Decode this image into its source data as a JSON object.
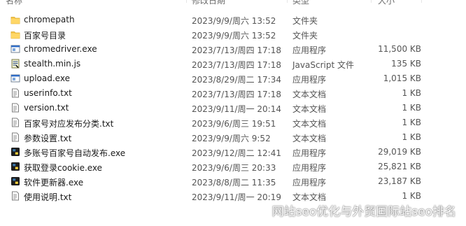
{
  "header": {
    "name_col": "名称",
    "date_col": "修改日期",
    "type_col": "类型",
    "size_col": "大小"
  },
  "files": [
    {
      "name": "chromepath",
      "date": "2023/9/9/周六 13:52",
      "type": "文件夹",
      "size": "",
      "icon": "folder-icon"
    },
    {
      "name": "百家号目录",
      "date": "2023/9/9/周六 13:52",
      "type": "文件夹",
      "size": "",
      "icon": "folder-icon"
    },
    {
      "name": "chromedriver.exe",
      "date": "2023/7/13/周四 17:18",
      "type": "应用程序",
      "size": "11,500 KB",
      "icon": "exe-window-icon"
    },
    {
      "name": "stealth.min.js",
      "date": "2023/7/13/周四 17:18",
      "type": "JavaScript 文件",
      "size": "135 KB",
      "icon": "script-icon"
    },
    {
      "name": "upload.exe",
      "date": "2023/8/29/周二 17:34",
      "type": "应用程序",
      "size": "1,015 KB",
      "icon": "exe-window-icon"
    },
    {
      "name": "userinfo.txt",
      "date": "2023/7/13/周四 17:18",
      "type": "文本文档",
      "size": "1 KB",
      "icon": "text-file-icon"
    },
    {
      "name": "version.txt",
      "date": "2023/9/11/周一 20:14",
      "type": "文本文档",
      "size": "1 KB",
      "icon": "text-file-icon"
    },
    {
      "name": "百家号对应发布分类.txt",
      "date": "2023/9/6/周三 19:51",
      "type": "文本文档",
      "size": "1 KB",
      "icon": "text-file-icon"
    },
    {
      "name": "参数设置.txt",
      "date": "2023/9/9/周六 9:52",
      "type": "文本文档",
      "size": "1 KB",
      "icon": "text-file-icon"
    },
    {
      "name": "多账号百家号自动发布.exe",
      "date": "2023/9/12/周二 12:41",
      "type": "应用程序",
      "size": "29,019 KB",
      "icon": "python-exe-icon"
    },
    {
      "name": "获取登录cookie.exe",
      "date": "2023/9/6/周三 20:33",
      "type": "应用程序",
      "size": "25,821 KB",
      "icon": "python-exe-icon"
    },
    {
      "name": "软件更新器.exe",
      "date": "2023/8/8/周二 11:35",
      "type": "应用程序",
      "size": "23,187 KB",
      "icon": "python-exe-icon"
    },
    {
      "name": "使用说明.txt",
      "date": "2023/9/11/周一 20:19",
      "type": "文本文档",
      "size": "1 KB",
      "icon": "text-file-icon"
    }
  ],
  "watermark": {
    "text": "网站seo优化与外贸国际站seo排名",
    "icon": "wechat-icon"
  }
}
